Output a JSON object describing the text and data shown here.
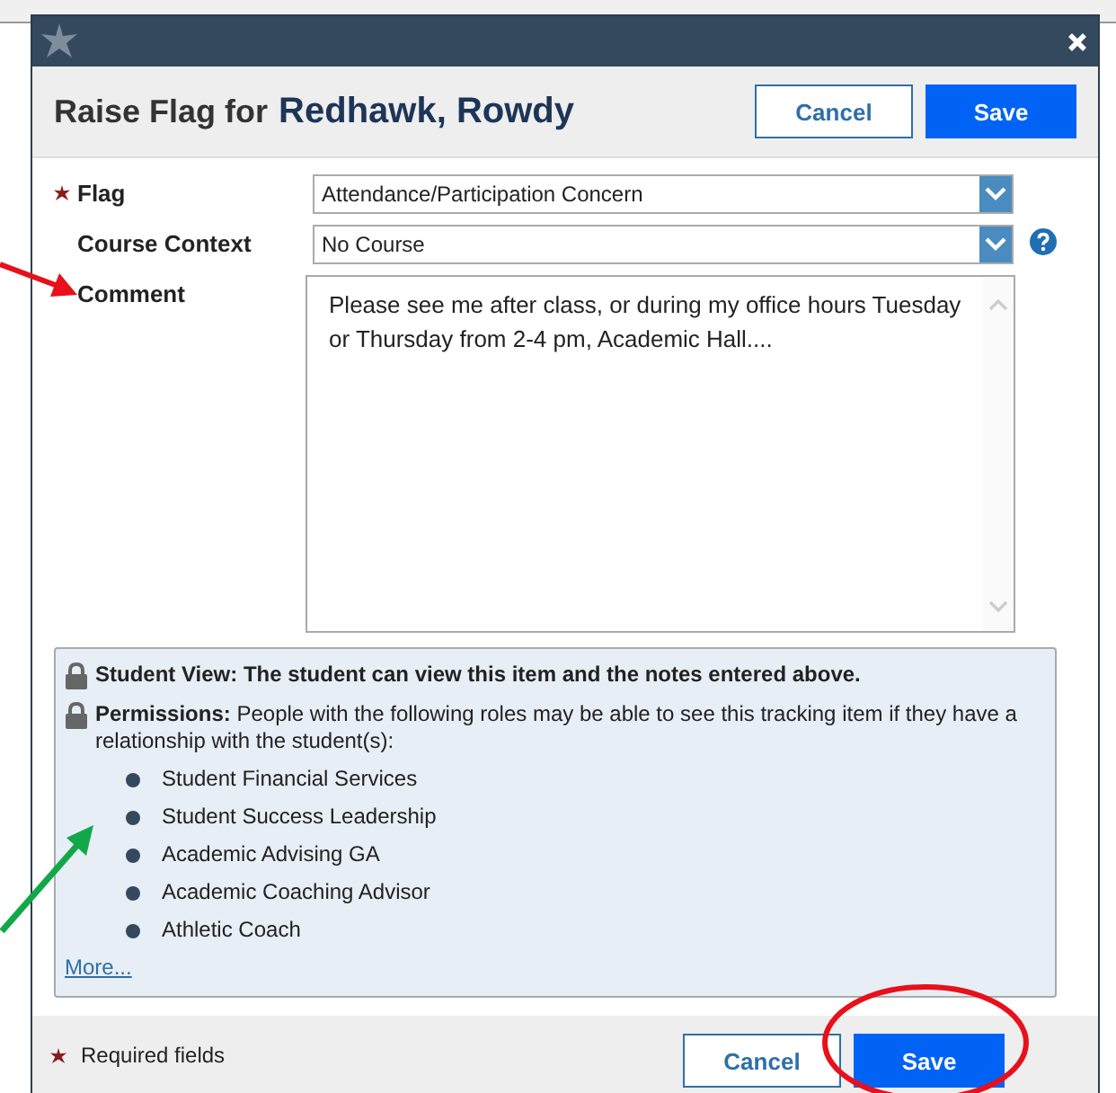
{
  "dialog": {
    "title_prefix": "Raise Flag for",
    "student_name": "Redhawk, Rowdy",
    "header_buttons": [
      {
        "label": "Cancel",
        "kind": "secondary"
      },
      {
        "label": "Save",
        "kind": "primary"
      }
    ],
    "fields": [
      {
        "label": "Flag",
        "required": true,
        "kind": "select",
        "value": "Attendance/Participation Concern",
        "help": false
      },
      {
        "label": "Course Context",
        "required": false,
        "kind": "select",
        "value": "No Course",
        "help": true
      },
      {
        "label": "Comment",
        "required": false,
        "kind": "textarea",
        "value": "Please see me after class, or during my office hours Tuesday\nor Thursday from 2-4 pm, Academic Hall...."
      }
    ],
    "notice": {
      "student_view": {
        "label": "Student View:",
        "text": "The student can view this item and the notes entered above."
      },
      "permissions": {
        "label": "Permissions:",
        "text": "People with the following roles may be able to see this tracking item if they have a relationship with the student(s):"
      },
      "roles": [
        "Student Financial Services",
        "Student Success Leadership",
        "Academic Advising GA",
        "Academic Coaching Advisor",
        "Athletic Coach"
      ],
      "more_link": "More..."
    },
    "footer": {
      "required_note": "Required fields",
      "buttons": [
        {
          "label": "Cancel",
          "kind": "secondary"
        },
        {
          "label": "Save",
          "kind": "primary"
        }
      ]
    }
  }
}
